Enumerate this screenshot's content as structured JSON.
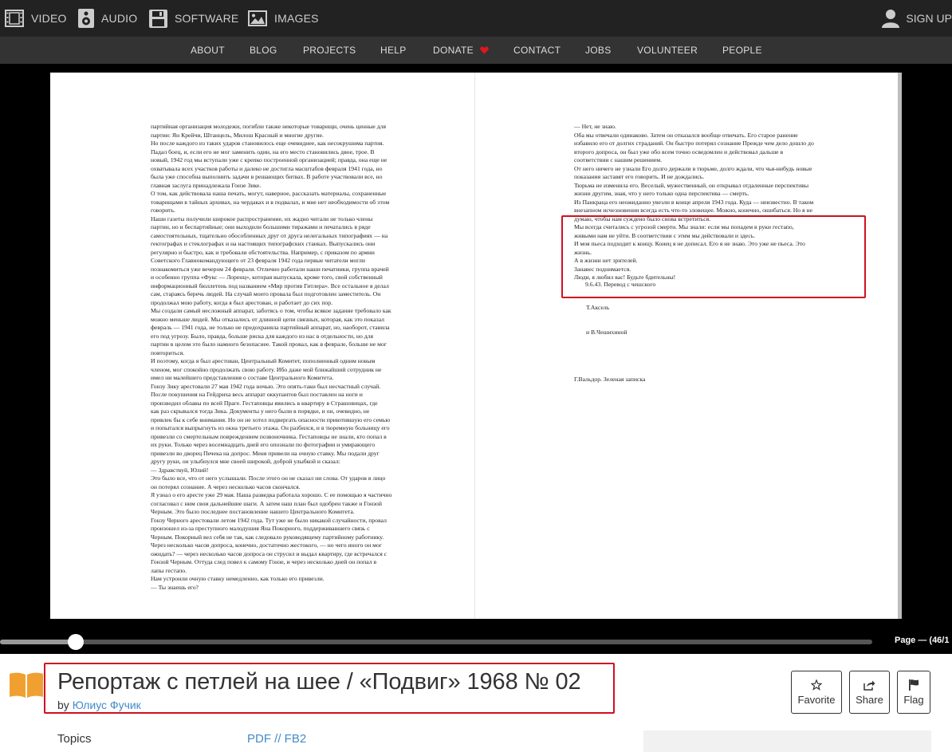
{
  "topnav": {
    "media": [
      {
        "label": "VIDEO",
        "icon": "film-icon"
      },
      {
        "label": "AUDIO",
        "icon": "speaker-icon"
      },
      {
        "label": "SOFTWARE",
        "icon": "floppy-disk-icon"
      },
      {
        "label": "IMAGES",
        "icon": "image-icon"
      }
    ],
    "signup": {
      "label": "SIGN UP",
      "icon": "user-icon"
    }
  },
  "subnav": {
    "items": [
      "ABOUT",
      "BLOG",
      "PROJECTS",
      "HELP",
      "DONATE",
      "CONTACT",
      "JOBS",
      "VOLUNTEER",
      "PEOPLE"
    ],
    "donate_icon": "heart-icon",
    "heart_color": "#e0161f"
  },
  "viewer": {
    "left_page_text": "партийная организация молодежи, погибли также некоторые товарищи, очень ценные для\nпартии: Ян Крейчи, Штанцель, Милош Красный и многие другие.\nНо после каждого из таких ударов становилось еще очевиднее, как несокрушима партия.\nПадал боец, и, если его не мог заменить один, на его место становились двое, трое. В\nновый, 1942 год мы вступали уже с крепко построенной организацией; правда, она еще не\nохватывала всех участков работы и далеко не достигла масштабов февраля 1941 года, но\nбыла уже способна выполнить задачи в решающих битвах. В работе участвовали все, но\nглавная заслуга принадлежала Гонзе Зике.\nО том, как действовала наша печать, могут, наверное, рассказать материалы, сохраненные\nтоварищами в тайных архивах, на чердаках и в подвалах, и мне нет необходимости об этом\nговорить.\nНаши газеты получили широкое распространение, их жадно читали не только члены\nпартии, но и беспартийные; они выходили большими тиражами и печатались в ряде\nсамостоятельных, тщательно обособленных друг от друга нелегальных типографиях — на\nгектографах и стеклографах и на настоящих типографских станках. Выпускались они\nрегулярно и быстро, как и требовали обстоятельства. Например, с приказом по армии\nСоветского Главнокомандующего от 23 февраля 1942 года первые читатели могли\nпознакомиться уже вечером 24 февраля. Отлично работали наши печатники, группа врачей\nи особенно группа «Фукс — Лоренц», которая выпускала, кроме того, свой собственный\nинформационный бюллетень под названием «Мир против Гитлера». Все остальное я делал\nсам, стараясь беречь людей. На случай моего провала был подготовлен заместитель. Он\nпродолжал мою работу, когда я был арестован, и работает до сих пор.\nМы создали самый несложный аппарат, заботясь о том, чтобы всякое задание требовало как\nможно меньше людей. Мы отказались от длинной цепи связных, которая, как это показал\nфевраль — 1941 года, не только не предохраняла партийный аппарат, но, наоборот, ставила\nего под угрозу. Было, правда, больше риска для каждого из нас в отдельности, но для\nпартии в целом это было намного безопаснее. Такой провал, как в феврале, больше не мог\nповториться.\nИ поэтому, когда я был арестован, Центральный Комитет, пополненный одним новым\nчленом, мог спокойно продолжать свою работу. Ибо даже мой ближайший сотрудник не\nимел ни малейшего представления о составе Центрального Комитета.\nГонзу Зику арестовали 27 мая 1942 года ночью. Это опять-таки был несчастный случай.\nПосле покушения на Гейдриха весь аппарат оккупантов был поставлен на ноги и\nпроизводил облавы по всей Праге. Гестаповцы явились в квартиру в Страшовицах, где\nкак раз скрывался тогда Зика. Документы у него были в порядке, и он, очевидно, не\nпривлек бы к себе внимания. Но он не хотел подвергать опасности приютившую его семью\nи попытался выпрыгнуть из окна третьего этажа. Он разбился, и в тюремную больницу его\nпривезли со смертельным повреждением позвоночника. Гестаповцы не знали, кто попал в\nих руки. Только через восемнадцать дней его опознали по фотографии и умирающего\nпривезли во дворец Печека на допрос. Меня привели на очную ставку. Мы подали друг\nдругу руки, он улыбнулся мне своей широкой, доброй улыбкой и сказал:\n— Здравствуй, Юлий!\nЭто было все, что от него услышали. После этого он не сказал ни слова. От ударов в лицо\nон потерял сознание. А через несколько часов скончался.\nЯ узнал о его аресте уже 29 мая. Наша разведка работала хорошо. С ее помощью я частично\nсогласовал с ним свои дальнейшие шаги. А затем наш план был одобрен также и Гонзой\nЧерным. Это было последнее постановление нашего Центрального Комитета.\nГонзу Черного арестовали летом 1942 года. Тут уже не было никакой случайности, провал\nпроизошел из-за преступного малодушия Яна Покорного, поддерживавшего связь с\nЧерным. Покорный вел себя не так, как следовало руководящему партийному работнику.\nЧерез несколько часов допроса, конечно, достаточно жестокого, — но чего иного он мог\nожидать? — через несколько часов допроса он струсил и выдал квартиру, где встречался с\nГонзой Черным. Оттуда след повел к самому Гонзе, и через несколько дней он попал в\nлапы гестапо.\nНам устроили очную ставку немедленно, как только его привезли.\n— Ты знаешь его?",
    "right_page_text_top": "— Нет, не знаю.\nОба мы отвечали одинаково. Затем он отказался вообще отвечать. Его старое ранение\nизбавило его от долгих страданий. Он быстро потерял сознание Прежде чем дело дошло до\nвторого допроса, он был уже обо всем точно осведомлен и действовал дальше в\nсоответствии с нашим решением.\nОт него ничего не узнали Его долго держали в тюрьме, долго ждали, что чья-нибудь новые\nпоказания заставят его говорить. И не дождались.\nТюрьма не изменила его. Веселый, мужественный, он открывал отдаленные перспективы\nжизни другим, зная, что у него только одна перспектива — смерть.\nИз Панкраца его неожиданно увезли в конце апреля 1943 года. Куда — неизвестно. В таком\nвнезапном исчезновении всегда есть что-то зловещее. Можно, конечно, ошибаться. Но я не\nдумаю, чтобы нам суждено было снова встретиться.",
    "right_page_text_highlighted": "Мы всегда считались с угрозой смерти. Мы знали: если мы попадем в руки гестапо,\nживыми нам не уйти. В соответствии с этим мы действовали и здесь.\nИ моя пьеса подходит к концу. Конец я не дописал. Его я не знаю. Это уже не пьеса. Это\nжизнь.\nА в жизни нет зрителей.\nЗанавес поднимается.\nЛюди, я любил вас! Будьте бдительны!",
    "right_page_date": "9.6.43. Перевод с чешского",
    "right_page_translator1": "Т.Аксель",
    "right_page_translator2": "и В.Чешихиной",
    "right_page_source": "Г.Вальдор. Зеленая записка",
    "scrubber_progress": 0.087,
    "page_label": "Page — (46/1"
  },
  "item": {
    "icon": "book-icon",
    "title": "Репортаж с петлей на шее / «Подвиг» 1968 № 02",
    "by_prefix": "by",
    "author": "Юлиус Фучик"
  },
  "actions": [
    {
      "label": "Favorite",
      "icon": "star-icon"
    },
    {
      "label": "Share",
      "icon": "share-icon"
    },
    {
      "label": "Flag",
      "icon": "flag-icon"
    }
  ],
  "metadata": {
    "topics_label": "Topics",
    "topics_value": "PDF // FB2"
  },
  "colors": {
    "highlight": "#d01020",
    "link": "#428bca",
    "book_icon": "#f0a030"
  }
}
